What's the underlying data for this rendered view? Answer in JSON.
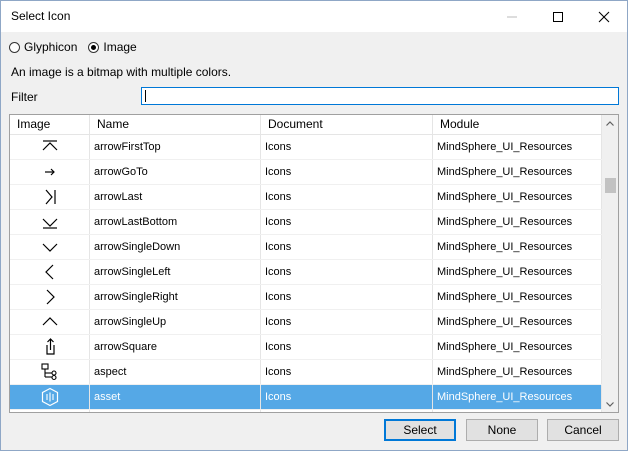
{
  "window": {
    "title": "Select Icon"
  },
  "type_options": [
    {
      "label": "Glyphicon",
      "selected": false
    },
    {
      "label": "Image",
      "selected": true
    }
  ],
  "description": "An image is a bitmap with multiple colors.",
  "filter": {
    "label": "Filter",
    "value": ""
  },
  "grid": {
    "columns": [
      "Image",
      "Name",
      "Document",
      "Module"
    ],
    "rows": [
      {
        "icon": "arrow-first-top-icon",
        "name": "arrowFirstTop",
        "document": "Icons",
        "module": "MindSphere_UI_Resources",
        "selected": false
      },
      {
        "icon": "arrow-goto-icon",
        "name": "arrowGoTo",
        "document": "Icons",
        "module": "MindSphere_UI_Resources",
        "selected": false
      },
      {
        "icon": "arrow-last-icon",
        "name": "arrowLast",
        "document": "Icons",
        "module": "MindSphere_UI_Resources",
        "selected": false
      },
      {
        "icon": "arrow-last-bottom-icon",
        "name": "arrowLastBottom",
        "document": "Icons",
        "module": "MindSphere_UI_Resources",
        "selected": false
      },
      {
        "icon": "arrow-single-down-icon",
        "name": "arrowSingleDown",
        "document": "Icons",
        "module": "MindSphere_UI_Resources",
        "selected": false
      },
      {
        "icon": "arrow-single-left-icon",
        "name": "arrowSingleLeft",
        "document": "Icons",
        "module": "MindSphere_UI_Resources",
        "selected": false
      },
      {
        "icon": "arrow-single-right-icon",
        "name": "arrowSingleRight",
        "document": "Icons",
        "module": "MindSphere_UI_Resources",
        "selected": false
      },
      {
        "icon": "arrow-single-up-icon",
        "name": "arrowSingleUp",
        "document": "Icons",
        "module": "MindSphere_UI_Resources",
        "selected": false
      },
      {
        "icon": "arrow-square-icon",
        "name": "arrowSquare",
        "document": "Icons",
        "module": "MindSphere_UI_Resources",
        "selected": false
      },
      {
        "icon": "aspect-icon",
        "name": "aspect",
        "document": "Icons",
        "module": "MindSphere_UI_Resources",
        "selected": false
      },
      {
        "icon": "asset-icon",
        "name": "asset",
        "document": "Icons",
        "module": "MindSphere_UI_Resources",
        "selected": true
      }
    ]
  },
  "buttons": {
    "select": "Select",
    "none": "None",
    "cancel": "Cancel"
  },
  "colors": {
    "selection": "#55a8e6",
    "focus": "#0078d7"
  }
}
